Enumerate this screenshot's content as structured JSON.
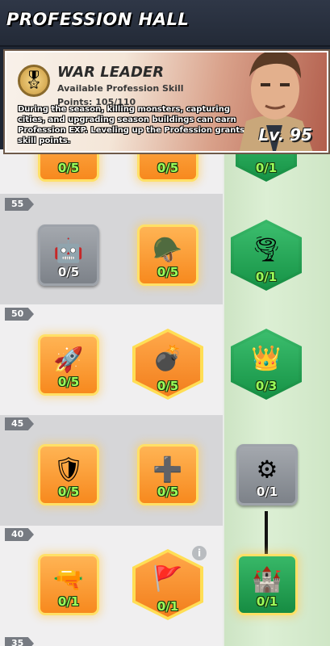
{
  "header": {
    "title": "PROFESSION HALL"
  },
  "profession": {
    "name": "WAR LEADER",
    "subtitle": "Available Profession Skill",
    "points": "Points: 105/110",
    "description": "During the season, killing monsters, capturing cities, and upgrading season buildings can earn Profession EXP. Leveling up the Profession grants skill points.",
    "level": "Lv. 95"
  },
  "levels": [
    "55",
    "50",
    "45",
    "40",
    "35"
  ],
  "nodes": {
    "top1": "0/5",
    "top2": "0/5",
    "top3": "0/1",
    "r55a": "0/5",
    "r55b": "0/5",
    "r55c": "0/1",
    "r50a": "0/5",
    "r50b": "0/5",
    "r50c": "0/3",
    "r45a": "0/5",
    "r45b": "0/5",
    "r45c": "0/1",
    "r40a": "0/1",
    "r40b": "0/1",
    "r40c": "0/1"
  },
  "info_label": "i"
}
